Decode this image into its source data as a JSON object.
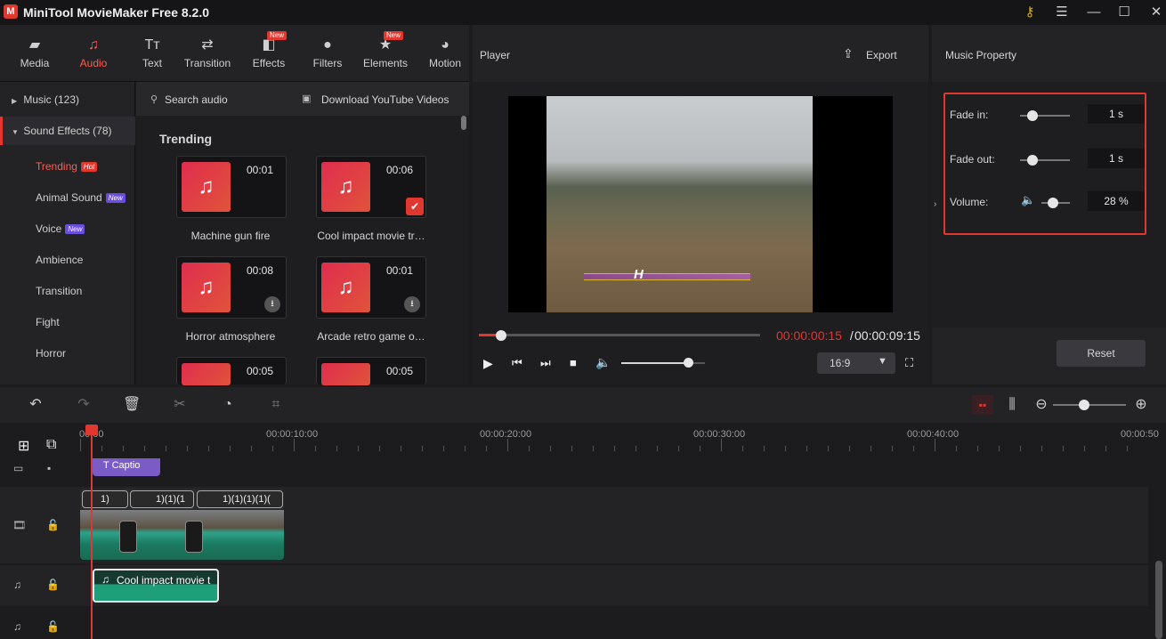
{
  "window": {
    "title": "MiniTool MovieMaker Free 8.2.0",
    "logo": "M"
  },
  "toolbar": {
    "tabs": [
      {
        "label": "Media",
        "icon": "folder-icon"
      },
      {
        "label": "Audio",
        "icon": "music-note-icon"
      },
      {
        "label": "Text",
        "icon": "text-icon"
      },
      {
        "label": "Transition",
        "icon": "transition-icon"
      },
      {
        "label": "Effects",
        "icon": "effects-icon",
        "badge": "New"
      },
      {
        "label": "Filters",
        "icon": "filters-icon"
      },
      {
        "label": "Elements",
        "icon": "elements-icon",
        "badge": "New"
      },
      {
        "label": "Motion",
        "icon": "motion-icon"
      }
    ]
  },
  "categories": {
    "music": "Music (123)",
    "sound_effects": "Sound Effects (78)",
    "sub": [
      {
        "label": "Trending",
        "tag": "Hot"
      },
      {
        "label": "Animal Sound",
        "tag": "New"
      },
      {
        "label": "Voice",
        "tag": "New"
      },
      {
        "label": "Ambience"
      },
      {
        "label": "Transition"
      },
      {
        "label": "Fight"
      },
      {
        "label": "Horror"
      }
    ]
  },
  "audio": {
    "search_label": "Search audio",
    "download_label": "Download YouTube Videos",
    "section_title": "Trending",
    "items": [
      {
        "name": "Machine gun fire",
        "duration": "00:01"
      },
      {
        "name": "Cool impact movie tr…",
        "duration": "00:06"
      },
      {
        "name": "Horror atmosphere",
        "duration": "00:08"
      },
      {
        "name": "Arcade retro game o…",
        "duration": "00:01"
      },
      {
        "name": "",
        "duration": "00:05"
      },
      {
        "name": "",
        "duration": "00:05"
      }
    ]
  },
  "player": {
    "title": "Player",
    "export_label": "Export",
    "overlay_text": "H",
    "current_time": "00:00:00:15",
    "separator": " / ",
    "total_time": "00:00:09:15",
    "progress": 0.08,
    "volume_level": 0.8,
    "aspect_ratio": "16:9"
  },
  "music_property": {
    "title": "Music Property",
    "fade_in_label": "Fade in:",
    "fade_in_value": "1 s",
    "fade_out_label": "Fade out:",
    "fade_out_value": "1 s",
    "volume_label": "Volume:",
    "volume_value": "28 %",
    "reset_label": "Reset"
  },
  "timeline": {
    "ruler_labels": [
      "00:00",
      "00:00:10:00",
      "00:00:20:00",
      "00:00:30:00",
      "00:00:40:00",
      "00:00:50"
    ],
    "caption_clip": "Captio",
    "video_clips": [
      "1)",
      "1)(1)(1",
      "1)(1)(1)(1)("
    ],
    "audio_clip": "Cool impact movie t"
  },
  "colors": {
    "accent": "#ff5a4f",
    "highlight_box": "#e0372f",
    "audio_clip": "#1f9e7a",
    "caption_clip": "#7b5cc7"
  }
}
